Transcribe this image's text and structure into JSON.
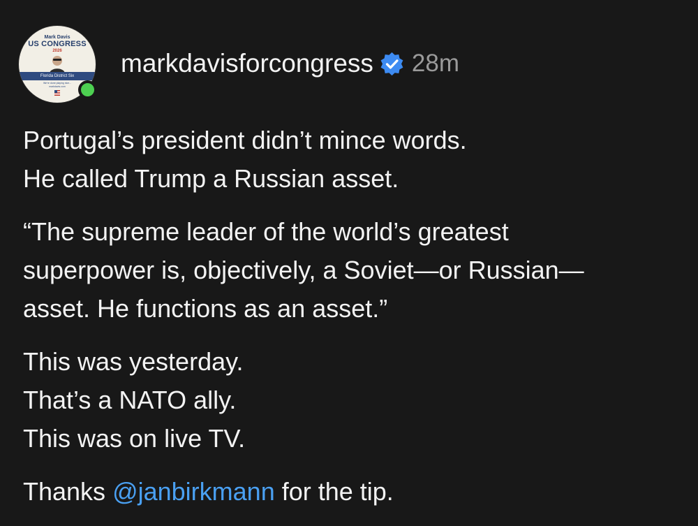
{
  "post": {
    "author": {
      "username": "markdavisforcongress",
      "verified": true,
      "avatar": {
        "name": "Mark Davis",
        "title": "US CONGRESS",
        "year": "2026",
        "band": "Florida District Six",
        "tagline": "We're done playing nice...",
        "site": "markdavis.com"
      },
      "online": true
    },
    "timestamp": "28m",
    "paragraphs": [
      {
        "lines": [
          "Portugal’s president didn’t mince words.",
          "He called Trump a Russian asset."
        ]
      },
      {
        "lines": [
          "“The supreme leader of the world’s greatest",
          "superpower is, objectively, a Soviet—or Russian—",
          "asset. He functions as an asset.”"
        ]
      },
      {
        "lines": [
          "This was yesterday.",
          "That’s a NATO ally.",
          "This was on live TV."
        ]
      }
    ],
    "closing": {
      "prefix": "Thanks ",
      "mention": "@janbirkmann",
      "suffix": " for the tip."
    }
  },
  "colors": {
    "background": "#181818",
    "text": "#f3f3f3",
    "muted": "#9a9a9a",
    "link": "#4aa0f2",
    "verified": "#3d8bf2",
    "online": "#4dd051"
  }
}
